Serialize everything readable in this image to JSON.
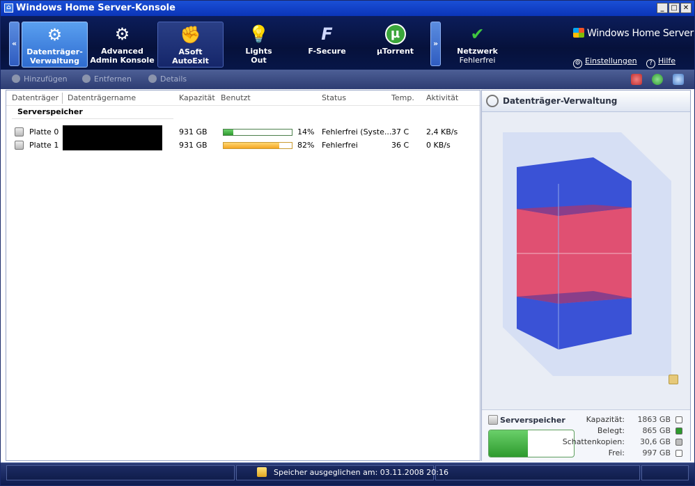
{
  "window": {
    "title": "Windows Home Server-Konsole",
    "colors": {
      "title_bar": "#0b35b8",
      "ribbon": "#06113b",
      "accent_blue": "#3a52d6",
      "accent_red": "#e05072",
      "used_green": "#2e9a2e",
      "used_orange": "#f5a623"
    }
  },
  "ribbon": {
    "tabs": [
      {
        "l1": "Datenträger-",
        "l2": "Verwaltung",
        "icon": "gear-icon"
      },
      {
        "l1": "Advanced",
        "l2": "Admin Konsole",
        "icon": "admin-console-icon"
      },
      {
        "l1": "ASoft",
        "l2": "AutoExit",
        "icon": "fist-icon"
      },
      {
        "l1": "Lights",
        "l2": "Out",
        "icon": "lightbulb-icon"
      },
      {
        "l1": "F-Secure",
        "l2": "",
        "icon": "f-secure-icon"
      },
      {
        "l1": "µTorrent",
        "l2": "",
        "icon": "utorrent-icon"
      },
      {
        "l1": "Netzwerk",
        "l2": "Fehlerfrei",
        "icon": "shield-check-icon"
      }
    ],
    "scroll_left": "«",
    "scroll_right": "»",
    "brand": "Windows Home Server",
    "settings": "Einstellungen",
    "help": "Hilfe"
  },
  "toolbar": {
    "add": "Hinzufügen",
    "remove": "Entfernen",
    "details": "Details"
  },
  "table": {
    "columns": [
      "Datenträger",
      "Datenträgername",
      "Kapazität",
      "Benutzt",
      "Status",
      "Temp.",
      "Aktivität"
    ],
    "group": "Serverspeicher",
    "rows": [
      {
        "name": "Platte 0",
        "capacity": "931 GB",
        "used_pct": "14%",
        "used_fraction": 0.14,
        "status": "Fehlerfrei (Syste...",
        "temp": "37 C",
        "activity": "2,4 KB/s"
      },
      {
        "name": "Platte 1",
        "capacity": "931 GB",
        "used_pct": "82%",
        "used_fraction": 0.82,
        "status": "Fehlerfrei",
        "temp": "36 C",
        "activity": "0 KB/s"
      }
    ]
  },
  "panel": {
    "title": "Datenträger-Verwaltung",
    "legend_title": "Serverspeicher",
    "used_fraction": 0.46,
    "items": [
      {
        "label": "Kapazität:",
        "value": "1863 GB",
        "color": "#ffffff"
      },
      {
        "label": "Belegt:",
        "value": "865 GB",
        "color": "#2e9a2e"
      },
      {
        "label": "Schattenkopien:",
        "value": "30,6 GB",
        "color": "#bdbdbd"
      },
      {
        "label": "Frei:",
        "value": "997 GB",
        "color": "#ffffff"
      }
    ]
  },
  "status": {
    "text": "Speicher ausgeglichen am: 03.11.2008 20:16"
  }
}
